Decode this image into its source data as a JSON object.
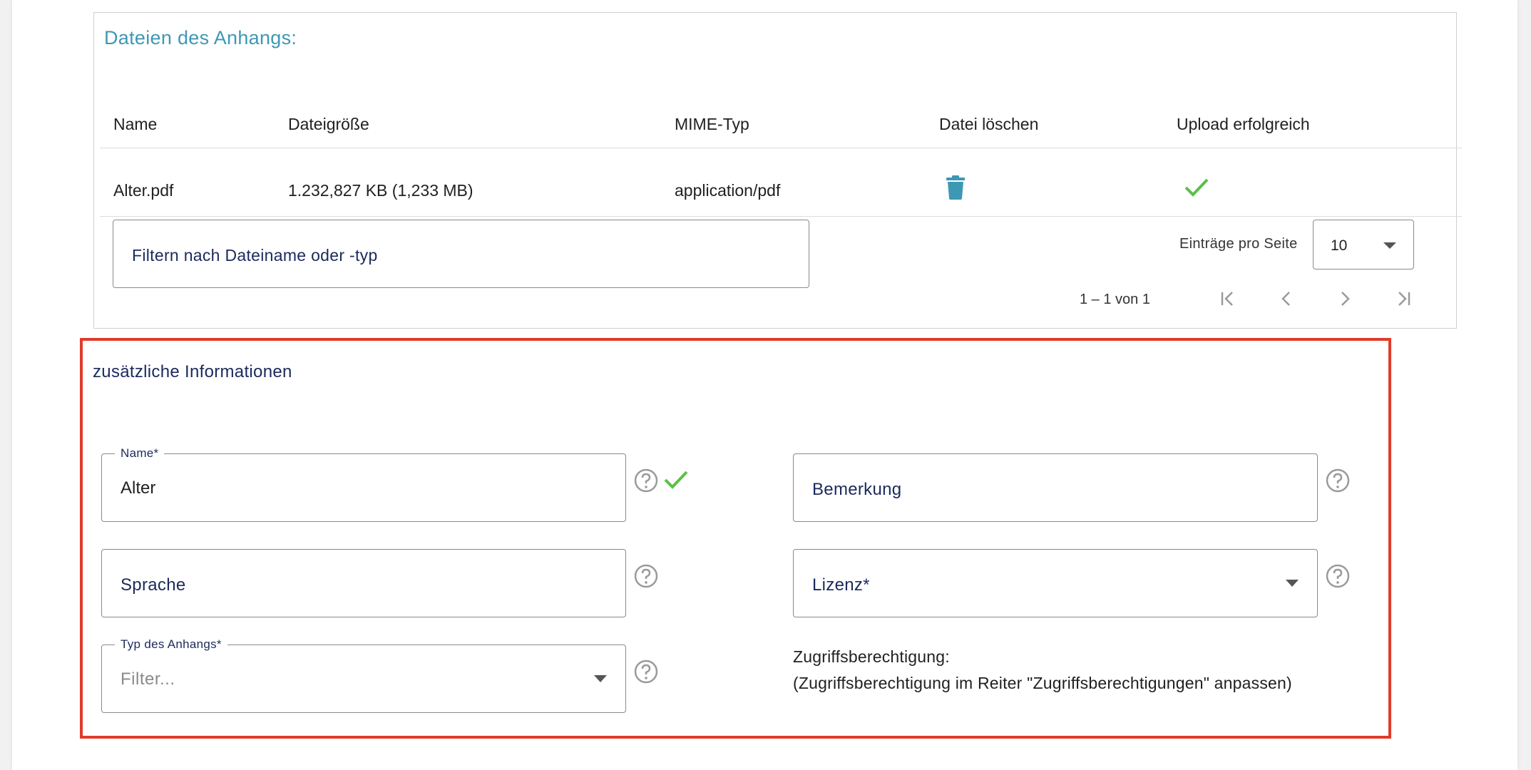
{
  "files_card": {
    "title": "Dateien des Anhangs:",
    "columns": [
      "Name",
      "Dateigröße",
      "MIME-Typ",
      "Datei löschen",
      "Upload erfolgreich"
    ],
    "rows": [
      {
        "name": "Alter.pdf",
        "size": "1.232,827 KB (1,233 MB)",
        "mime": "application/pdf",
        "delete_icon": "trash-icon",
        "success_icon": "check-icon"
      }
    ],
    "filter_placeholder": "Filtern nach Dateiname oder -typ",
    "per_page_label": "Einträge pro Seite",
    "per_page_value": "10",
    "range_label": "1 – 1 von 1"
  },
  "additional_info": {
    "title": "zusätzliche Informationen",
    "name_field": {
      "label": "Name*",
      "value": "Alter"
    },
    "bemerkung_field": {
      "placeholder": "Bemerkung"
    },
    "sprache_field": {
      "placeholder": "Sprache"
    },
    "lizenz_field": {
      "placeholder": "Lizenz*"
    },
    "typ_field": {
      "label": "Typ des Anhangs*",
      "placeholder": "Filter..."
    },
    "access_title": "Zugriffsberechtigung:",
    "access_note": "(Zugriffsberechtigung im Reiter \"Zugriffsberechtigungen\" anpassen)"
  },
  "colors": {
    "accent_teal": "#3d98b4",
    "navy_text": "#1b2a5c",
    "success_green": "#5cbf4a",
    "highlight_red": "#e03c2a"
  }
}
